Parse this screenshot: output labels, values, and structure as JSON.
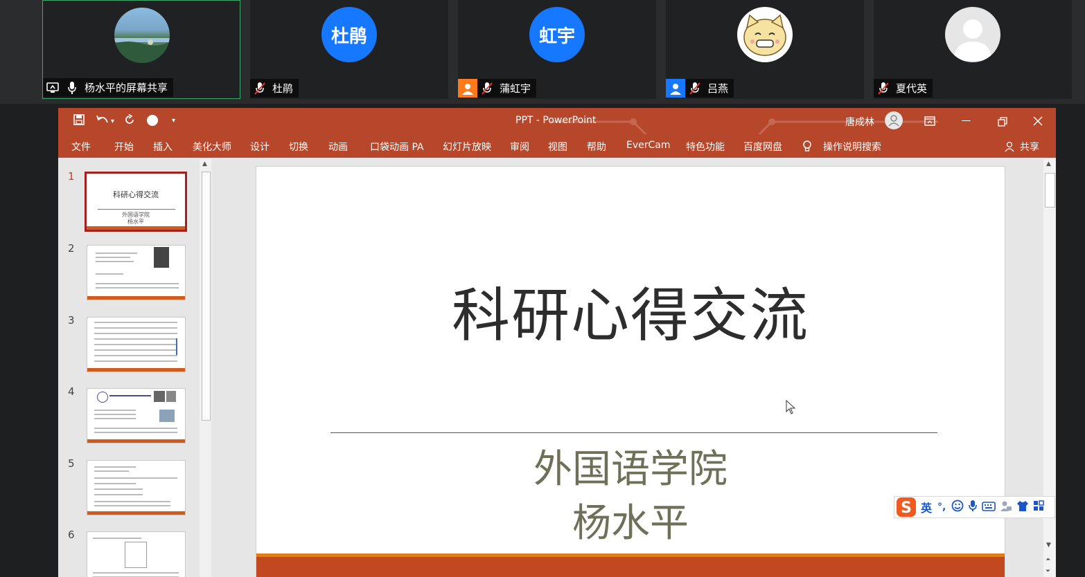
{
  "meeting": {
    "participants": [
      {
        "name": "杨水平的屏幕共享",
        "avatar_type": "photo",
        "sharing": true,
        "mic": "on"
      },
      {
        "name": "杜鹃",
        "avatar_text": "杜鹃",
        "avatar_type": "blue",
        "mic": "muted"
      },
      {
        "name": "蒲虹宇",
        "avatar_text": "虹宇",
        "avatar_type": "blue",
        "mic": "muted",
        "badge": "person-orange"
      },
      {
        "name": "吕燕",
        "avatar_type": "cat",
        "mic": "muted",
        "badge": "person-blue"
      },
      {
        "name": "夏代英",
        "avatar_type": "gray",
        "mic": "muted"
      }
    ]
  },
  "ppt": {
    "window_title": "PPT  -  PowerPoint",
    "user_name": "唐成林",
    "menu": [
      "文件",
      "开始",
      "插入",
      "美化大师",
      "设计",
      "切换",
      "动画",
      "口袋动画 PA",
      "幻灯片放映",
      "审阅",
      "视图",
      "帮助",
      "EverCam",
      "特色功能",
      "百度网盘"
    ],
    "tell_me": "操作说明搜索",
    "share": "共享",
    "thumbnails": [
      {
        "number": "1",
        "title": "科研心得交流",
        "subtitle1": "外国语学院",
        "subtitle2": "杨水平"
      },
      {
        "number": "2"
      },
      {
        "number": "3"
      },
      {
        "number": "4"
      },
      {
        "number": "5"
      },
      {
        "number": "6"
      }
    ],
    "slide": {
      "title": "科研心得交流",
      "subtitle1": "外国语学院",
      "subtitle2": "杨水平"
    }
  },
  "ime": {
    "mode": "英",
    "punct": "°,"
  },
  "colors": {
    "ppt_accent": "#b7472a",
    "zoom_blue": "#1677ff",
    "active_tile_border": "#3ea86a",
    "slide_orange": "#e07d1b",
    "slide_rust": "#c2481f"
  }
}
